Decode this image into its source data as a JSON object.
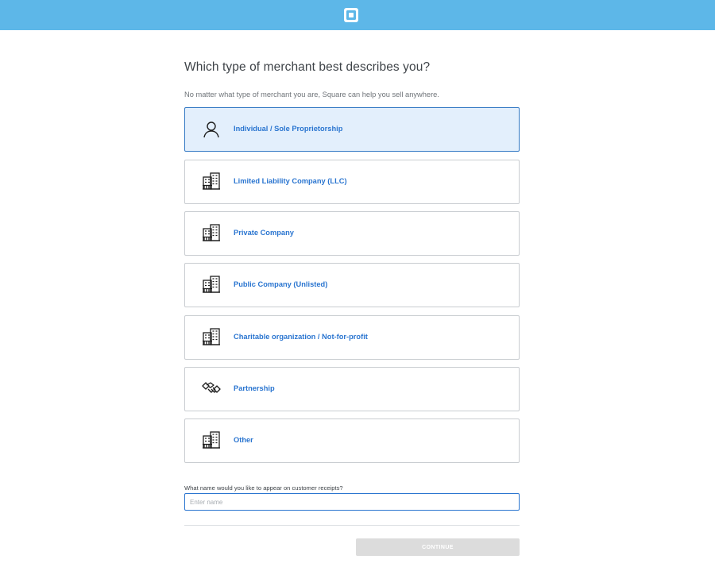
{
  "header": {
    "logo_icon": "square-logo-icon",
    "bar_color": "#5db7e8"
  },
  "main": {
    "title": "Which type of merchant best describes you?",
    "subtitle": "No matter what type of merchant you are, Square can help you sell anywhere."
  },
  "options": [
    {
      "label": "Individual / Sole Proprietorship",
      "icon": "person-icon",
      "selected": true
    },
    {
      "label": "Limited Liability Company (LLC)",
      "icon": "building-icon",
      "selected": false
    },
    {
      "label": "Private Company",
      "icon": "building-icon",
      "selected": false
    },
    {
      "label": "Public Company (Unlisted)",
      "icon": "building-icon",
      "selected": false
    },
    {
      "label": "Charitable organization / Not-for-profit",
      "icon": "building-icon",
      "selected": false
    },
    {
      "label": "Partnership",
      "icon": "handshake-icon",
      "selected": false
    },
    {
      "label": "Other",
      "icon": "building-icon",
      "selected": false
    }
  ],
  "receipt_name": {
    "label": "What name would you like to appear on customer receipts?",
    "placeholder": "Enter name",
    "value": ""
  },
  "actions": {
    "continue_label": "CONTINUE"
  },
  "colors": {
    "accent": "#2a75d0",
    "selected_bg": "#e3effc",
    "disabled_button": "#dcdcdc"
  }
}
